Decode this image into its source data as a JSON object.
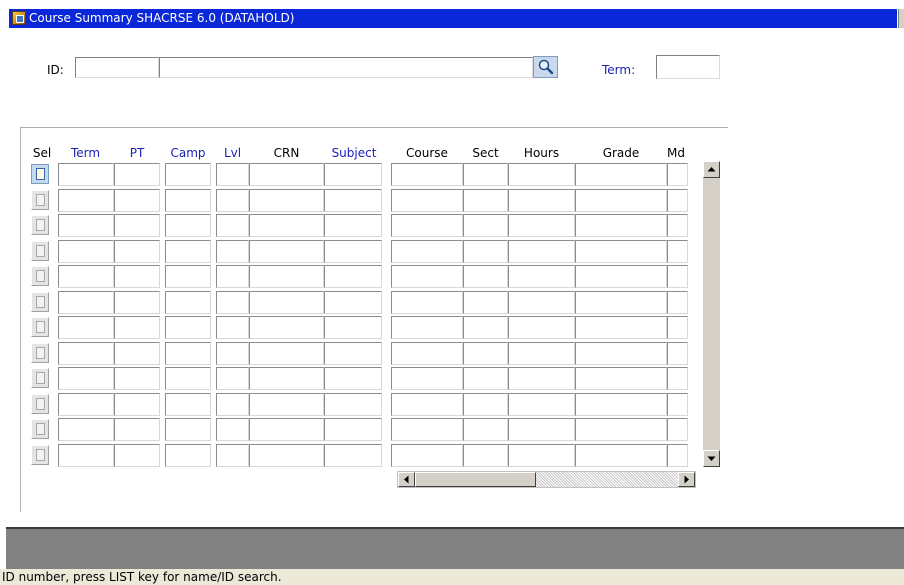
{
  "window": {
    "title": "Course Summary  SHACRSE  6.0  (DATAHOLD)",
    "icon": "oracle-forms-app-icon"
  },
  "key_block": {
    "id_label": "ID:",
    "id_value": "",
    "name_value": "",
    "search_icon": "magnifier-icon",
    "term_label": "Term:",
    "term_value": ""
  },
  "grid": {
    "columns": [
      {
        "key": "sel",
        "label": "Sel",
        "color": "#000000"
      },
      {
        "key": "term",
        "label": "Term",
        "color": "#1c20b8"
      },
      {
        "key": "pt",
        "label": "PT",
        "color": "#1c20b8"
      },
      {
        "key": "camp",
        "label": "Camp",
        "color": "#1c20b8"
      },
      {
        "key": "lvl",
        "label": "Lvl",
        "color": "#1c20b8"
      },
      {
        "key": "crn",
        "label": "CRN",
        "color": "#000000"
      },
      {
        "key": "subject",
        "label": "Subject",
        "color": "#1c20b8"
      },
      {
        "key": "course",
        "label": "Course",
        "color": "#000000"
      },
      {
        "key": "sect",
        "label": "Sect",
        "color": "#000000"
      },
      {
        "key": "hours",
        "label": "Hours",
        "color": "#000000"
      },
      {
        "key": "grade",
        "label": "Grade",
        "color": "#000000"
      },
      {
        "key": "md",
        "label": "Md",
        "color": "#000000"
      }
    ],
    "row_count": 12,
    "active_row": 0,
    "row_select_icon": "document-icon",
    "scroll_up_icon": "arrow-up-icon",
    "scroll_down_icon": "arrow-down-icon",
    "scroll_left_icon": "arrow-left-icon",
    "scroll_right_icon": "arrow-right-icon"
  },
  "status": {
    "message": "ID number, press LIST key for name/ID search."
  },
  "colors": {
    "title_bar": "#0a28d8",
    "label_blue": "#1c20b8",
    "status_bar": "#ece9d8",
    "bottom_bar": "#828282"
  }
}
